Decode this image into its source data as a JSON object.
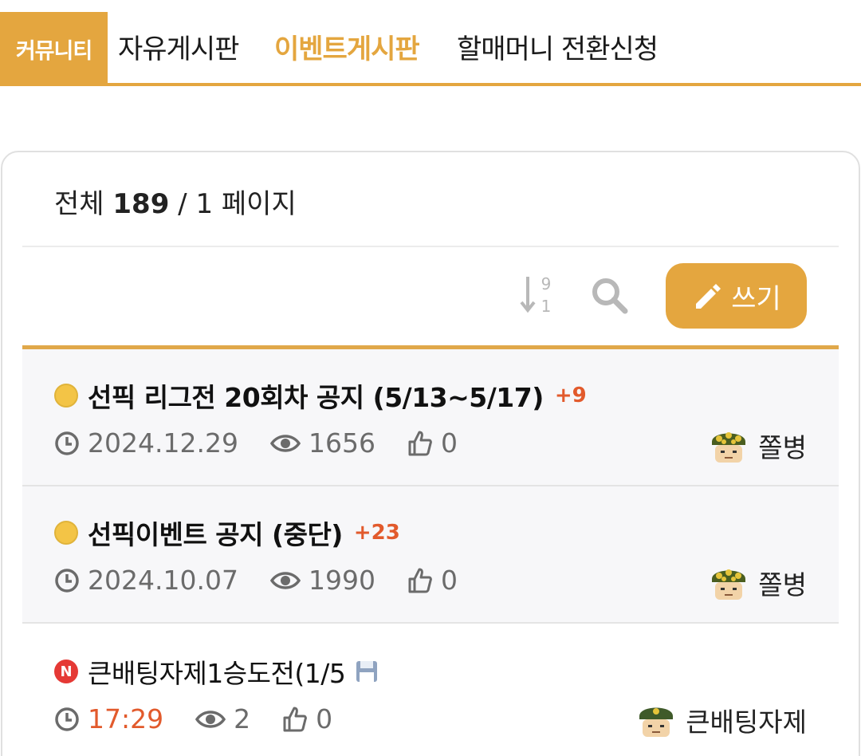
{
  "nav": {
    "badge": "커뮤니티",
    "tabs": [
      {
        "label": "자유게시판",
        "active": false
      },
      {
        "label": "이벤트게시판",
        "active": true
      },
      {
        "label": "할매머니 전환신청",
        "active": false
      }
    ]
  },
  "board": {
    "summary_prefix": "전체",
    "total": "189",
    "page_sep": "/",
    "page": "1",
    "page_suffix": "페이지",
    "write_label": "쓰기",
    "sort_digits": [
      "9",
      "1"
    ]
  },
  "posts": [
    {
      "icon": "notice-dot-icon",
      "title": "선픽 리그전 20회차 공지 (5/13~5/17)",
      "comments": "+9",
      "date": "2024.12.29",
      "views": "1656",
      "likes": "0",
      "author": "쫄병"
    },
    {
      "icon": "notice-dot-icon",
      "title": "선픽이벤트 공지 (중단)",
      "comments": "+23",
      "date": "2024.10.07",
      "views": "1990",
      "likes": "0",
      "author": "쫄병"
    },
    {
      "icon": "new-badge-icon",
      "new_badge": "N",
      "title": "큰배팅자제1승도전(1/5",
      "date": "17:29",
      "views": "2",
      "likes": "0",
      "author": "큰배팅자제"
    }
  ],
  "colors": {
    "accent": "#e4a63f",
    "comment": "#e25a2c",
    "notice_bg": "#f7f7f9",
    "new_badge": "#e53935"
  }
}
